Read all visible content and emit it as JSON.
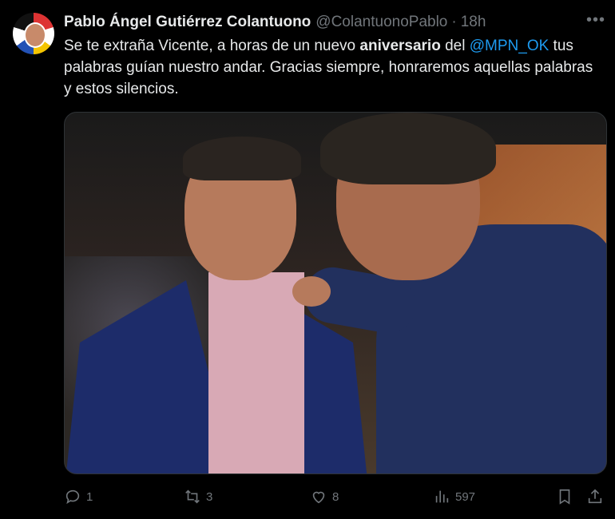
{
  "author": {
    "name": "Pablo Ángel Gutiérrez Colantuono",
    "handle": "@ColantuonoPablo",
    "separator": "·",
    "time": "18h"
  },
  "more_icon": "more-horizontal-icon",
  "tweet_text": {
    "part1": "Se te extraña Vicente, a horas de un nuevo ",
    "bold": "aniversario",
    "part2": " del ",
    "mention": "@MPN_OK",
    "part3": " tus palabras guían nuestro andar. Gracias siempre, honraremos aquellas palabras y estos silencios."
  },
  "actions": {
    "reply": {
      "icon": "reply-icon",
      "count": "1"
    },
    "retweet": {
      "icon": "retweet-icon",
      "count": "3"
    },
    "like": {
      "icon": "heart-icon",
      "count": "8"
    },
    "views": {
      "icon": "views-icon",
      "count": "597"
    },
    "bookmark": {
      "icon": "bookmark-icon"
    },
    "share": {
      "icon": "share-icon"
    }
  },
  "colors": {
    "background": "#000000",
    "text": "#e7e9ea",
    "muted": "#71767b",
    "link": "#1d9bf0"
  }
}
